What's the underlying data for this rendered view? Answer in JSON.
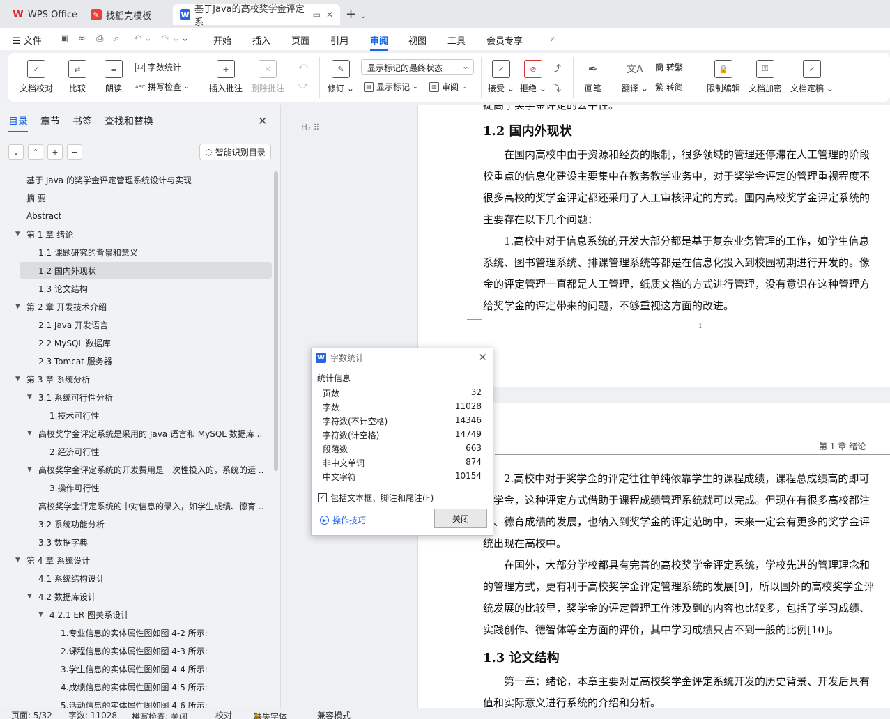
{
  "tabs": [
    {
      "label": "WPS Office",
      "icon": "wps-logo-icon"
    },
    {
      "label": "找稻壳模板",
      "icon": "docer-icon"
    },
    {
      "label": "基于Java的高校奖学金评定系",
      "icon": "word-doc-icon"
    }
  ],
  "menu": {
    "file": "文件",
    "items": [
      "开始",
      "插入",
      "页面",
      "引用",
      "审阅",
      "视图",
      "工具",
      "会员专享"
    ],
    "active": "审阅"
  },
  "ribbon": {
    "doc_proof": "文档校对",
    "compare": "比较",
    "read_aloud": "朗读",
    "word_count": "字数统计",
    "spell_check": "拼写检查",
    "insert_comment": "插入批注",
    "delete_comment": "删除批注",
    "track": "修订",
    "markup_state": "显示标记的最终状态",
    "show_markup": "显示标记",
    "review_pane": "审阅",
    "accept": "接受",
    "reject": "拒绝",
    "pen": "画笔",
    "translate": "翻译",
    "to_traditional": "转繁",
    "to_simplified": "转简",
    "restrict_edit": "限制编辑",
    "encrypt": "文档加密",
    "finalize": "文档定稿"
  },
  "nav": {
    "tabs": [
      "目录",
      "章节",
      "书签",
      "查找和替换"
    ],
    "smart_btn": "智能识别目录",
    "toc": [
      {
        "text": "基于 Java 的奖学金评定管理系统设计与实现",
        "level": 0,
        "arrow": false
      },
      {
        "text": "摘  要",
        "level": 0,
        "arrow": false
      },
      {
        "text": "Abstract",
        "level": 0,
        "arrow": false
      },
      {
        "text": "第 1 章  绪论",
        "level": 0,
        "arrow": true
      },
      {
        "text": "1.1  课题研究的背景和意义",
        "level": 1,
        "arrow": false
      },
      {
        "text": "1.2  国内外现状",
        "level": 1,
        "arrow": false,
        "selected": true
      },
      {
        "text": "1.3  论文结构",
        "level": 1,
        "arrow": false
      },
      {
        "text": "第 2 章  开发技术介绍",
        "level": 0,
        "arrow": true
      },
      {
        "text": "2.1 Java 开发语言",
        "level": 1,
        "arrow": false
      },
      {
        "text": "2.2 MySQL 数据库",
        "level": 1,
        "arrow": false
      },
      {
        "text": "2.3 Tomcat 服务器",
        "level": 1,
        "arrow": false
      },
      {
        "text": "第 3 章  系统分析",
        "level": 0,
        "arrow": true
      },
      {
        "text": "3.1 系统可行性分析",
        "level": 1,
        "arrow": true
      },
      {
        "text": "1.技术可行性",
        "level": 2,
        "arrow": false
      },
      {
        "text": "高校奖学金评定系统是采用的 Java 语言和 MySQL 数据库 ...",
        "level": 1,
        "arrow": true
      },
      {
        "text": "2.经济可行性",
        "level": 2,
        "arrow": false
      },
      {
        "text": "高校奖学金评定系统的开发费用是一次性投入的，系统的运 ...",
        "level": 1,
        "arrow": true
      },
      {
        "text": "3.操作可行性",
        "level": 2,
        "arrow": false
      },
      {
        "text": "高校奖学金评定系统的中对信息的录入，如学生成绩、德育 ...",
        "level": 1,
        "arrow": false
      },
      {
        "text": "3.2 系统功能分析",
        "level": 1,
        "arrow": false
      },
      {
        "text": "3.3  数据字典",
        "level": 1,
        "arrow": false
      },
      {
        "text": "第 4 章  系统设计",
        "level": 0,
        "arrow": true
      },
      {
        "text": "4.1 系统结构设计",
        "level": 1,
        "arrow": false
      },
      {
        "text": "4.2 数据库设计",
        "level": 1,
        "arrow": true
      },
      {
        "text": "4.2.1 ER 图关系设计",
        "level": 2,
        "arrow": true
      },
      {
        "text": "1.专业信息的实体属性图如图 4-2 所示:",
        "level": 3,
        "arrow": false
      },
      {
        "text": "2.课程信息的实体属性图如图 4-3 所示:",
        "level": 3,
        "arrow": false
      },
      {
        "text": "3.学生信息的实体属性图如图 4-4 所示:",
        "level": 3,
        "arrow": false
      },
      {
        "text": "4.成绩信息的实体属性图如图 4-5 所示:",
        "level": 3,
        "arrow": false
      },
      {
        "text": "5.活动信息的实体属性图如图 4-6 所示:",
        "level": 3,
        "arrow": false
      }
    ]
  },
  "doc": {
    "page1": {
      "top_cut": "提高了奖学金评定的公平性。",
      "heading": "1.2  国内外现状",
      "h_tag": "H₂",
      "lines": [
        "在国内高校中由于资源和经费的限制，很多领域的管理还停滞在人工管理的阶段",
        "校重点的信息化建设主要集中在教务教学业务中，对于奖学金评定的管理重视程度不",
        "很多高校的奖学金评定都还采用了人工审核评定的方式。国内高校奖学金评定系统的",
        "主要存在以下几个问题：",
        "1.高校中对于信息系统的开发大部分都是基于复杂业务管理的工作，如学生信息",
        "系统、图书管理系统、排课管理系统等都是在信息化投入到校园初期进行开发的。像",
        "金的评定管理一直都是人工管理，纸质文档的方式进行管理，没有意识在这种管理方",
        "给奖学金的评定带来的问题，不够重视这方面的改进。"
      ],
      "page_number": "1"
    },
    "page2": {
      "header": "第 1 章  绪论",
      "lines": [
        "2.高校中对于奖学金的评定往往单纯依靠学生的课程成绩，课程总成绩高的即可",
        "学金，这种评定方式借助于课程成绩管理系统就可以完成。但现在有很多高校都注",
        "、德育成绩的发展，也纳入到奖学金的评定范畴中，未来一定会有更多的奖学金评",
        "统出现在高校中。",
        "在国外，大部分学校都具有完善的高校奖学金评定系统，学校先进的管理理念和",
        "的管理方式，更有利于高校奖学金评定管理系统的发展[9]，所以国外的高校奖学金评",
        "统发展的比较早，奖学金的评定管理工作涉及到的内容也比较多，包括了学习成绩、",
        "实践创作、德智体等全方面的评价，其中学习成绩只占不到一般的比例[10]。"
      ],
      "heading": "1.3  论文结构",
      "lines_after": [
        "第一章：绪论，本章主要对是高校奖学金评定系统开发的历史背景、开发后具有",
        "值和实际意义进行系统的介绍和分析。"
      ]
    }
  },
  "dialog": {
    "title": "字数统计",
    "section": "统计信息",
    "stats": [
      {
        "label": "页数",
        "value": "32"
      },
      {
        "label": "字数",
        "value": "11028"
      },
      {
        "label": "字符数(不计空格)",
        "value": "14346"
      },
      {
        "label": "字符数(计空格)",
        "value": "14749"
      },
      {
        "label": "段落数",
        "value": "663"
      },
      {
        "label": "非中文单词",
        "value": "874"
      },
      {
        "label": "中文字符",
        "value": "10154"
      }
    ],
    "checkbox_label": "包括文本框、脚注和尾注(F)",
    "checkbox_checked": true,
    "tips": "操作技巧",
    "close": "关闭"
  },
  "status": {
    "page": "页面: 5/32",
    "words": "字数: 11028",
    "spell": "拼写检查: 关闭",
    "proof": "校对",
    "missing_font": "缺失字体",
    "compat": "兼容模式"
  }
}
